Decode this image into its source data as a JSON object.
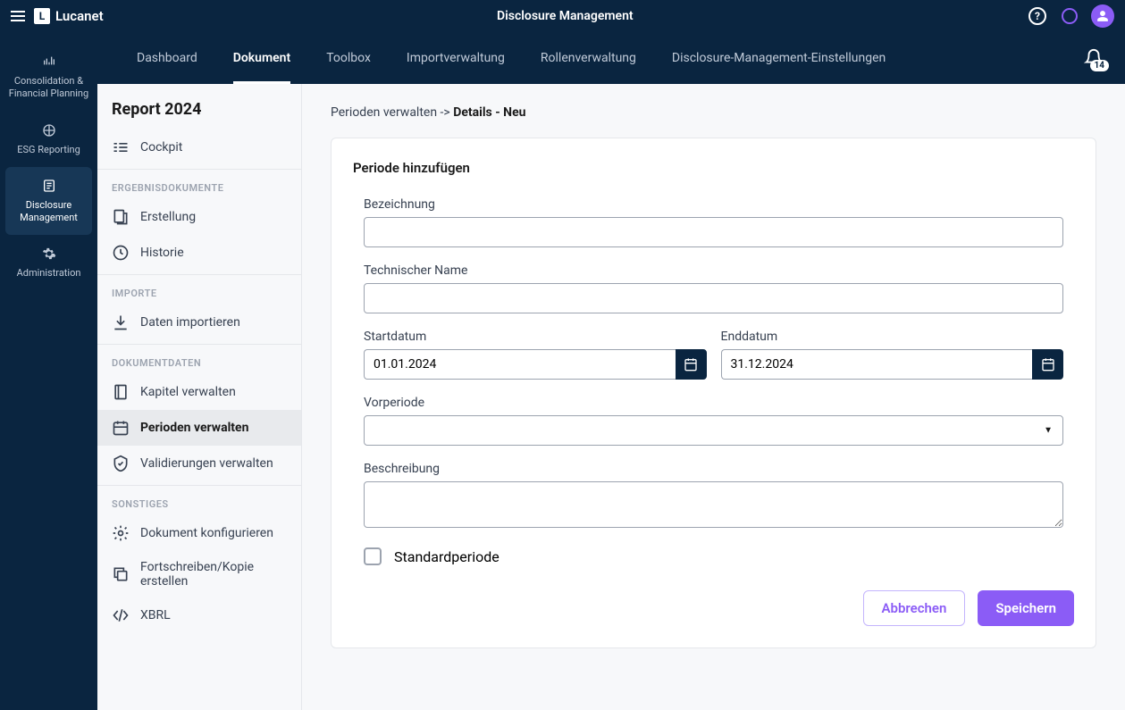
{
  "topbar": {
    "brand": "Lucanet",
    "title": "Disclosure Management"
  },
  "leftrail": [
    {
      "label": "Consolidation & Financial Planning",
      "icon": "chart"
    },
    {
      "label": "ESG Reporting",
      "icon": "esg"
    },
    {
      "label": "Disclosure Management",
      "icon": "doc",
      "active": true
    },
    {
      "label": "Administration",
      "icon": "gear"
    }
  ],
  "navtabs": {
    "items": [
      {
        "label": "Dashboard"
      },
      {
        "label": "Dokument",
        "active": true
      },
      {
        "label": "Toolbox"
      },
      {
        "label": "Importverwaltung"
      },
      {
        "label": "Rollenverwaltung"
      },
      {
        "label": "Disclosure-Management-Einstellungen"
      }
    ],
    "bell_count": "14"
  },
  "sidebar": {
    "title": "Report 2024",
    "groups": [
      {
        "items": [
          {
            "label": "Cockpit",
            "icon": "cockpit"
          }
        ]
      },
      {
        "label": "ERGEBNISDOKUMENTE",
        "items": [
          {
            "label": "Erstellung",
            "icon": "create"
          },
          {
            "label": "Historie",
            "icon": "history"
          }
        ]
      },
      {
        "label": "IMPORTE",
        "items": [
          {
            "label": "Daten importieren",
            "icon": "import"
          }
        ]
      },
      {
        "label": "DOKUMENTDATEN",
        "items": [
          {
            "label": "Kapitel verwalten",
            "icon": "chapters"
          },
          {
            "label": "Perioden verwalten",
            "icon": "periods",
            "active": true
          },
          {
            "label": "Validierungen verwalten",
            "icon": "validate"
          }
        ]
      },
      {
        "label": "SONSTIGES",
        "items": [
          {
            "label": "Dokument konfigurieren",
            "icon": "config"
          },
          {
            "label": "Fortschreiben/Kopie erstellen",
            "icon": "copy"
          },
          {
            "label": "XBRL",
            "icon": "xbrl"
          }
        ]
      }
    ]
  },
  "breadcrumb": {
    "parent": "Perioden verwalten",
    "sep": " -> ",
    "current": "Details - Neu"
  },
  "form": {
    "title": "Periode hinzufügen",
    "fields": {
      "bezeichnung": {
        "label": "Bezeichnung",
        "value": ""
      },
      "technischer_name": {
        "label": "Technischer Name",
        "value": ""
      },
      "startdatum": {
        "label": "Startdatum",
        "value": "01.01.2024"
      },
      "enddatum": {
        "label": "Enddatum",
        "value": "31.12.2024"
      },
      "vorperiode": {
        "label": "Vorperiode",
        "value": ""
      },
      "beschreibung": {
        "label": "Beschreibung",
        "value": ""
      },
      "standardperiode": {
        "label": "Standardperiode",
        "checked": false
      }
    },
    "actions": {
      "cancel": "Abbrechen",
      "save": "Speichern"
    }
  }
}
